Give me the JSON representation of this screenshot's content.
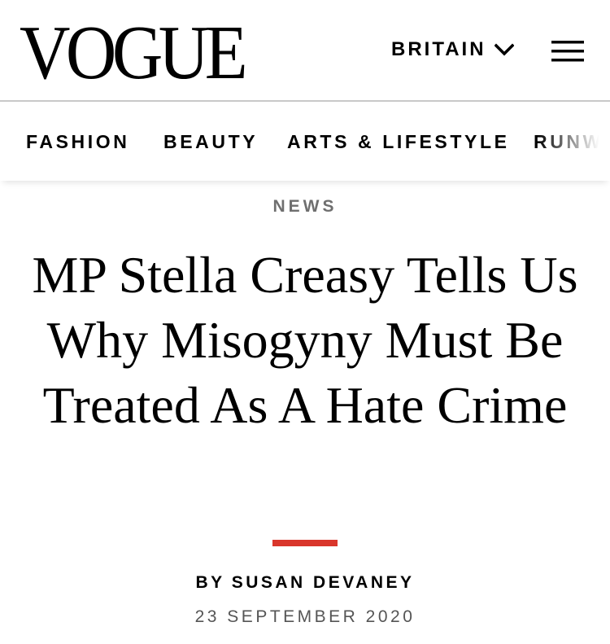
{
  "header": {
    "logo_text": "VOGUE",
    "edition_label": "BRITAIN",
    "edition_icon": "chevron-down-icon",
    "menu_icon": "hamburger-menu-icon"
  },
  "nav": {
    "items": [
      {
        "label": "FASHION"
      },
      {
        "label": "BEAUTY"
      },
      {
        "label": "ARTS & LIFESTYLE"
      },
      {
        "label": "RUNWAY"
      }
    ]
  },
  "article": {
    "kicker": "NEWS",
    "headline": "MP Stella Creasy Tells Us Why Misogyny Must Be Treated As A Hate Crime",
    "byline_prefix": "BY",
    "author": "SUSAN DEVANEY",
    "date": "23 SEPTEMBER 2020"
  },
  "colors": {
    "accent": "#d9362b",
    "kicker_text": "#6f6f6f",
    "date_text": "#555555",
    "divider": "#c9c9c9"
  }
}
